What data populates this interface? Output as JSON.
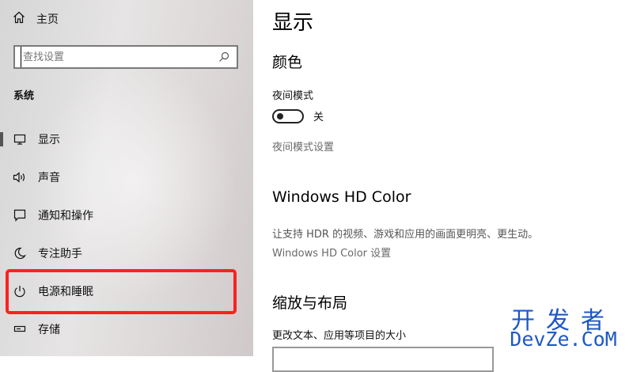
{
  "sidebar": {
    "home_label": "主页",
    "search_placeholder": "查找设置",
    "section_label": "系统",
    "items": [
      {
        "label": "显示",
        "icon": "monitor-icon",
        "selected": true
      },
      {
        "label": "声音",
        "icon": "speaker-icon"
      },
      {
        "label": "通知和操作",
        "icon": "notification-icon"
      },
      {
        "label": "专注助手",
        "icon": "moon-icon"
      },
      {
        "label": "电源和睡眠",
        "icon": "power-icon"
      },
      {
        "label": "存储",
        "icon": "storage-icon"
      }
    ]
  },
  "main": {
    "title": "显示",
    "color_section": {
      "heading": "颜色",
      "night_mode_label": "夜间模式",
      "toggle_state": "关",
      "night_mode_settings_link": "夜间模式设置"
    },
    "hd_color_section": {
      "heading": "Windows HD Color",
      "description": "让支持 HDR 的视频、游戏和应用的画面更明亮、更生动。",
      "settings_link": "Windows HD Color 设置"
    },
    "scale_section": {
      "heading": "缩放与布局",
      "label": "更改文本、应用等项目的大小"
    }
  },
  "watermark": {
    "top": "开发者",
    "bottom": "DevZe.CoM"
  },
  "colors": {
    "highlight_border": "#ff2020",
    "watermark": "#1f58c4"
  }
}
